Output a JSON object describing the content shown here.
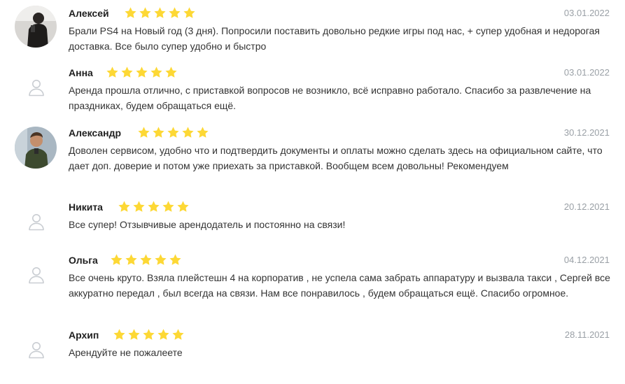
{
  "colors": {
    "star": "#FDD835",
    "date": "#9AA0A6",
    "placeholder": "#C9CDD2"
  },
  "reviews": [
    {
      "author": "Алексей",
      "rating": 5,
      "date": "03.01.2022",
      "avatar": "user-photo",
      "text": "Брали PS4 на Новый год (3 дня). Попросили поставить довольно редкие игры под нас, + супер удобная и недорогая доставка. Все было супер удобно и быстро"
    },
    {
      "author": "Анна",
      "rating": 5,
      "date": "03.01.2022",
      "avatar": "user-placeholder-icon",
      "text": "Аренда прошла отлично, с приставкой вопросов не возникло, всё исправно работало. Спасибо за развлечение на праздниках, будем обращаться ещё."
    },
    {
      "author": "Александр",
      "rating": 5,
      "date": "30.12.2021",
      "avatar": "user-photo",
      "text": "Доволен сервисом, удобно что и подтвердить документы и оплаты можно сделать здесь на официальном сайте, что дает доп. доверие и потом уже приехать за приставкой. Вообщем всем довольны! Рекомендуем"
    },
    {
      "author": "Никита",
      "rating": 5,
      "date": "20.12.2021",
      "avatar": "user-placeholder-icon",
      "text": "Все супер! Отзывчивые арендодатель и постоянно на связи!"
    },
    {
      "author": "Ольга",
      "rating": 5,
      "date": "04.12.2021",
      "avatar": "user-placeholder-icon",
      "text": "Все очень круто. Взяла плейстешн 4 на корпоратив , не успела сама забрать аппаратуру и вызвала такси , Сергей все аккуратно передал , был всегда на связи. Нам все понравилось , будем обращаться ещё. Спасибо огромное."
    },
    {
      "author": "Архип",
      "rating": 5,
      "date": "28.11.2021",
      "avatar": "user-placeholder-icon",
      "text": "Арендуйте не пожалеете"
    }
  ]
}
